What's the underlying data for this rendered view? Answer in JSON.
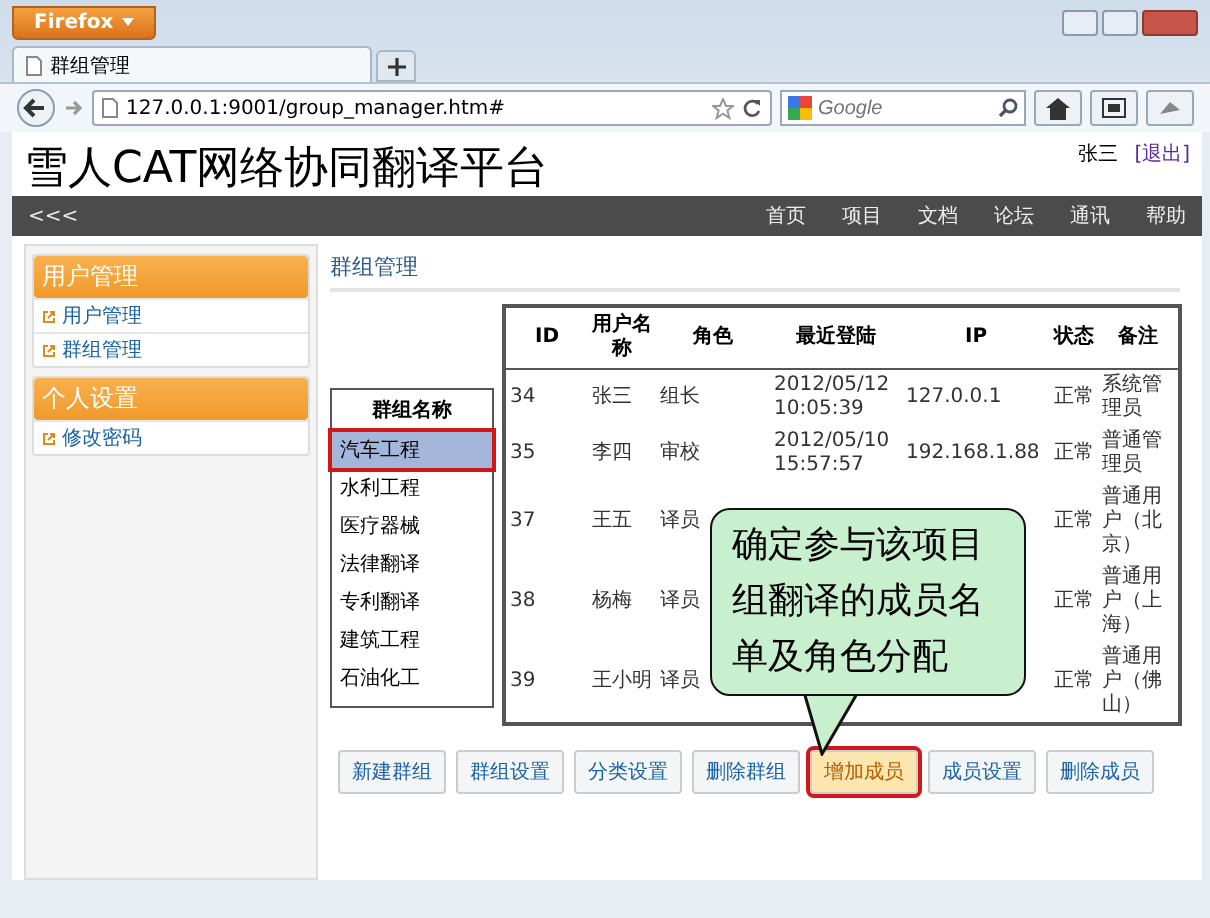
{
  "browser": {
    "app_button": "Firefox",
    "tab_title": "群组管理",
    "url": "127.0.0.1:9001/group_manager.htm#",
    "search_placeholder": "Google"
  },
  "header": {
    "title": "雪人CAT网络协同翻译平台",
    "user": "张三",
    "logout": "[退出]"
  },
  "nav": {
    "collapse": "<<<",
    "items": [
      "首页",
      "项目",
      "文档",
      "论坛",
      "通讯",
      "帮助"
    ]
  },
  "sidebar": {
    "sections": [
      {
        "title": "用户管理",
        "items": [
          "用户管理",
          "群组管理"
        ]
      },
      {
        "title": "个人设置",
        "items": [
          "修改密码"
        ]
      }
    ]
  },
  "page_title": "群组管理",
  "group_list": {
    "heading": "群组名称",
    "items": [
      {
        "label": "汽车工程",
        "selected": true
      },
      {
        "label": "水利工程",
        "selected": false
      },
      {
        "label": "医疗器械",
        "selected": false
      },
      {
        "label": "法律翻译",
        "selected": false
      },
      {
        "label": "专利翻译",
        "selected": false
      },
      {
        "label": "建筑工程",
        "selected": false
      },
      {
        "label": "石油化工",
        "selected": false
      }
    ]
  },
  "table": {
    "columns": [
      "ID",
      "用户名称",
      "角色",
      "最近登陆",
      "IP",
      "状态",
      "备注"
    ],
    "rows": [
      {
        "id": "34",
        "name": "张三",
        "role": "组长",
        "last_login": "2012/05/12 10:05:39",
        "ip": "127.0.0.1",
        "status": "正常",
        "note": "系统管理员"
      },
      {
        "id": "35",
        "name": "李四",
        "role": "审校",
        "last_login": "2012/05/10 15:57:57",
        "ip": "192.168.1.88",
        "status": "正常",
        "note": "普通管理员"
      },
      {
        "id": "37",
        "name": "王五",
        "role": "译员",
        "status": "正常",
        "note": "普通用户（北京）"
      },
      {
        "id": "38",
        "name": "杨梅",
        "role": "译员",
        "status": "正常",
        "note": "普通用户（上海）"
      },
      {
        "id": "39",
        "name": "王小明",
        "role": "译员",
        "status": "正常",
        "note": "普通用户（佛山）"
      }
    ]
  },
  "callout": "确定参与该项目组翻译的成员名单及角色分配",
  "buttons": [
    {
      "label": "新建群组",
      "highlighted": false
    },
    {
      "label": "群组设置",
      "highlighted": false
    },
    {
      "label": "分类设置",
      "highlighted": false
    },
    {
      "label": "删除群组",
      "highlighted": false
    },
    {
      "label": "增加成员",
      "highlighted": true
    },
    {
      "label": "成员设置",
      "highlighted": false
    },
    {
      "label": "删除成员",
      "highlighted": false
    }
  ]
}
